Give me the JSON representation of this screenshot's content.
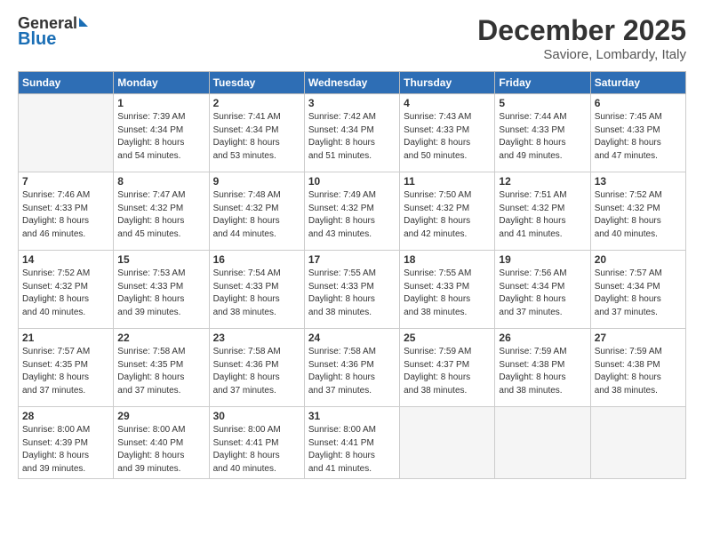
{
  "logo": {
    "general": "General",
    "blue": "Blue"
  },
  "title": "December 2025",
  "subtitle": "Saviore, Lombardy, Italy",
  "days_of_week": [
    "Sunday",
    "Monday",
    "Tuesday",
    "Wednesday",
    "Thursday",
    "Friday",
    "Saturday"
  ],
  "weeks": [
    [
      {
        "num": "",
        "info": ""
      },
      {
        "num": "1",
        "info": "Sunrise: 7:39 AM\nSunset: 4:34 PM\nDaylight: 8 hours\nand 54 minutes."
      },
      {
        "num": "2",
        "info": "Sunrise: 7:41 AM\nSunset: 4:34 PM\nDaylight: 8 hours\nand 53 minutes."
      },
      {
        "num": "3",
        "info": "Sunrise: 7:42 AM\nSunset: 4:34 PM\nDaylight: 8 hours\nand 51 minutes."
      },
      {
        "num": "4",
        "info": "Sunrise: 7:43 AM\nSunset: 4:33 PM\nDaylight: 8 hours\nand 50 minutes."
      },
      {
        "num": "5",
        "info": "Sunrise: 7:44 AM\nSunset: 4:33 PM\nDaylight: 8 hours\nand 49 minutes."
      },
      {
        "num": "6",
        "info": "Sunrise: 7:45 AM\nSunset: 4:33 PM\nDaylight: 8 hours\nand 47 minutes."
      }
    ],
    [
      {
        "num": "7",
        "info": "Sunrise: 7:46 AM\nSunset: 4:33 PM\nDaylight: 8 hours\nand 46 minutes."
      },
      {
        "num": "8",
        "info": "Sunrise: 7:47 AM\nSunset: 4:32 PM\nDaylight: 8 hours\nand 45 minutes."
      },
      {
        "num": "9",
        "info": "Sunrise: 7:48 AM\nSunset: 4:32 PM\nDaylight: 8 hours\nand 44 minutes."
      },
      {
        "num": "10",
        "info": "Sunrise: 7:49 AM\nSunset: 4:32 PM\nDaylight: 8 hours\nand 43 minutes."
      },
      {
        "num": "11",
        "info": "Sunrise: 7:50 AM\nSunset: 4:32 PM\nDaylight: 8 hours\nand 42 minutes."
      },
      {
        "num": "12",
        "info": "Sunrise: 7:51 AM\nSunset: 4:32 PM\nDaylight: 8 hours\nand 41 minutes."
      },
      {
        "num": "13",
        "info": "Sunrise: 7:52 AM\nSunset: 4:32 PM\nDaylight: 8 hours\nand 40 minutes."
      }
    ],
    [
      {
        "num": "14",
        "info": "Sunrise: 7:52 AM\nSunset: 4:32 PM\nDaylight: 8 hours\nand 40 minutes."
      },
      {
        "num": "15",
        "info": "Sunrise: 7:53 AM\nSunset: 4:33 PM\nDaylight: 8 hours\nand 39 minutes."
      },
      {
        "num": "16",
        "info": "Sunrise: 7:54 AM\nSunset: 4:33 PM\nDaylight: 8 hours\nand 38 minutes."
      },
      {
        "num": "17",
        "info": "Sunrise: 7:55 AM\nSunset: 4:33 PM\nDaylight: 8 hours\nand 38 minutes."
      },
      {
        "num": "18",
        "info": "Sunrise: 7:55 AM\nSunset: 4:33 PM\nDaylight: 8 hours\nand 38 minutes."
      },
      {
        "num": "19",
        "info": "Sunrise: 7:56 AM\nSunset: 4:34 PM\nDaylight: 8 hours\nand 37 minutes."
      },
      {
        "num": "20",
        "info": "Sunrise: 7:57 AM\nSunset: 4:34 PM\nDaylight: 8 hours\nand 37 minutes."
      }
    ],
    [
      {
        "num": "21",
        "info": "Sunrise: 7:57 AM\nSunset: 4:35 PM\nDaylight: 8 hours\nand 37 minutes."
      },
      {
        "num": "22",
        "info": "Sunrise: 7:58 AM\nSunset: 4:35 PM\nDaylight: 8 hours\nand 37 minutes."
      },
      {
        "num": "23",
        "info": "Sunrise: 7:58 AM\nSunset: 4:36 PM\nDaylight: 8 hours\nand 37 minutes."
      },
      {
        "num": "24",
        "info": "Sunrise: 7:58 AM\nSunset: 4:36 PM\nDaylight: 8 hours\nand 37 minutes."
      },
      {
        "num": "25",
        "info": "Sunrise: 7:59 AM\nSunset: 4:37 PM\nDaylight: 8 hours\nand 38 minutes."
      },
      {
        "num": "26",
        "info": "Sunrise: 7:59 AM\nSunset: 4:38 PM\nDaylight: 8 hours\nand 38 minutes."
      },
      {
        "num": "27",
        "info": "Sunrise: 7:59 AM\nSunset: 4:38 PM\nDaylight: 8 hours\nand 38 minutes."
      }
    ],
    [
      {
        "num": "28",
        "info": "Sunrise: 8:00 AM\nSunset: 4:39 PM\nDaylight: 8 hours\nand 39 minutes."
      },
      {
        "num": "29",
        "info": "Sunrise: 8:00 AM\nSunset: 4:40 PM\nDaylight: 8 hours\nand 39 minutes."
      },
      {
        "num": "30",
        "info": "Sunrise: 8:00 AM\nSunset: 4:41 PM\nDaylight: 8 hours\nand 40 minutes."
      },
      {
        "num": "31",
        "info": "Sunrise: 8:00 AM\nSunset: 4:41 PM\nDaylight: 8 hours\nand 41 minutes."
      },
      {
        "num": "",
        "info": ""
      },
      {
        "num": "",
        "info": ""
      },
      {
        "num": "",
        "info": ""
      }
    ]
  ]
}
